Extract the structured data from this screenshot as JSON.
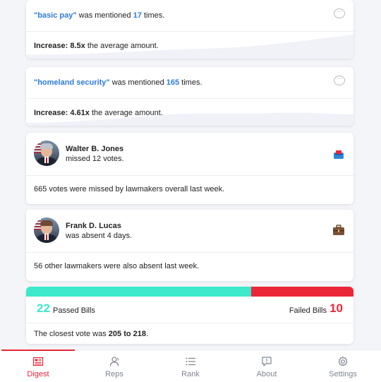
{
  "mentions": [
    {
      "keyword": "\"basic pay\"",
      "middle": " was mentioned ",
      "count": "17",
      "suffix": " times.",
      "increase_label": "Increase: 8.5x",
      "increase_suffix": " the average amount."
    },
    {
      "keyword": "\"homeland security\"",
      "middle": " was mentioned ",
      "count": "165",
      "suffix": " times.",
      "increase_label": "Increase: 4.61x",
      "increase_suffix": " the average amount."
    }
  ],
  "reps": [
    {
      "name": "Walter B. Jones",
      "desc": "missed 12 votes.",
      "icon": "ballot-box-icon",
      "summary": "665 votes were missed by lawmakers overall last week."
    },
    {
      "name": "Frank D. Lucas",
      "desc": "was absent 4 days.",
      "icon": "briefcase-icon",
      "summary": "56 other lawmakers were also absent last week."
    }
  ],
  "bills": {
    "passed": "22",
    "passed_label": "Passed Bills",
    "failed_label": "Failed Bills",
    "failed": "10",
    "closest_prefix": "The closest vote was ",
    "closest_value": "205 to 218",
    "closest_suffix": "."
  },
  "tabs": [
    {
      "label": "Digest",
      "icon": "newspaper-icon",
      "active": true
    },
    {
      "label": "Reps",
      "icon": "people-icon",
      "active": false
    },
    {
      "label": "Rank",
      "icon": "list-icon",
      "active": false
    },
    {
      "label": "About",
      "icon": "chat-info-icon",
      "active": false
    },
    {
      "label": "Settings",
      "icon": "gear-icon",
      "active": false
    }
  ],
  "colors": {
    "accent": "#ec2639",
    "passed": "#3de8cb",
    "failed": "#ec2639",
    "keyword": "#2d7bdc"
  }
}
